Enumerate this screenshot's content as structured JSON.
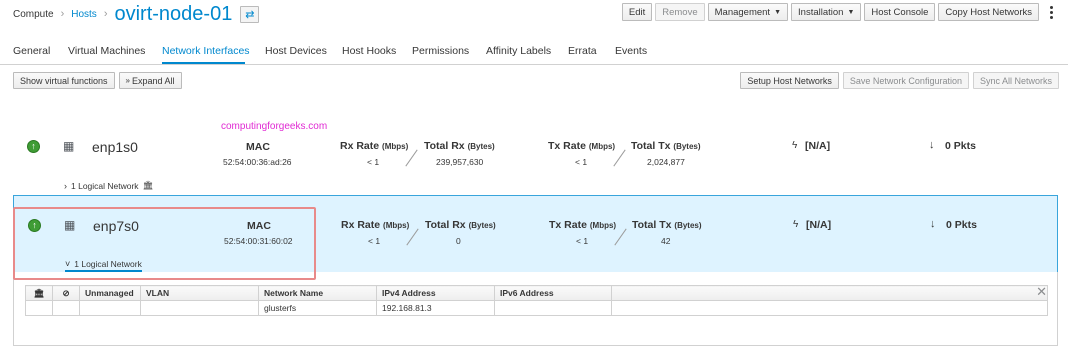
{
  "breadcrumb": {
    "compute": "Compute",
    "hosts": "Hosts",
    "title": "ovirt-node-01",
    "sep": "›"
  },
  "toolbar": {
    "edit": "Edit",
    "remove": "Remove",
    "management": "Management",
    "installation": "Installation",
    "host_console": "Host Console",
    "copy_networks": "Copy Host Networks"
  },
  "tabs": [
    "General",
    "Virtual Machines",
    "Network Interfaces",
    "Host Devices",
    "Host Hooks",
    "Permissions",
    "Affinity Labels",
    "Errata",
    "Events"
  ],
  "active_tab": "Network Interfaces",
  "subtoolbar": {
    "show_vf": "Show virtual functions",
    "expand_all": "Expand All",
    "setup_networks": "Setup Host Networks",
    "save_config": "Save Network Configuration",
    "sync_all": "Sync All Networks"
  },
  "watermark": "computingforgeeks.com",
  "labels": {
    "mac": "MAC",
    "rx_rate": "Rx Rate",
    "rx_rate_unit": "(Mbps)",
    "total_rx": "Total Rx",
    "total_rx_unit": "(Bytes)",
    "tx_rate": "Tx Rate",
    "tx_rate_unit": "(Mbps)",
    "total_tx": "Total Tx",
    "total_tx_unit": "(Bytes)"
  },
  "nics": [
    {
      "name": "enp1s0",
      "mac": "52:54:00:36:ad:26",
      "rx_rate": "< 1",
      "total_rx": "239,957,630",
      "tx_rate": "< 1",
      "total_tx": "2,024,877",
      "speed": "[N/A]",
      "drops": "0 Pkts",
      "logical": "1 Logical Network"
    },
    {
      "name": "enp7s0",
      "mac": "52:54:00:31:60:02",
      "rx_rate": "< 1",
      "total_rx": "0",
      "tx_rate": "< 1",
      "total_tx": "42",
      "speed": "[N/A]",
      "drops": "0 Pkts",
      "logical": "1 Logical Network"
    }
  ],
  "detail_table": {
    "headers": [
      "Unmanaged",
      "VLAN",
      "Network Name",
      "IPv4 Address",
      "IPv6 Address"
    ],
    "rows": [
      {
        "unmanaged": "",
        "vlan": "",
        "network": "glusterfs",
        "ipv4": "192.168.81.3",
        "ipv6": ""
      }
    ]
  },
  "colors": {
    "accent": "#0088ce",
    "selected_bg": "#def3ff",
    "status_up": "#3f9c35",
    "highlight": "#e88a8a"
  }
}
